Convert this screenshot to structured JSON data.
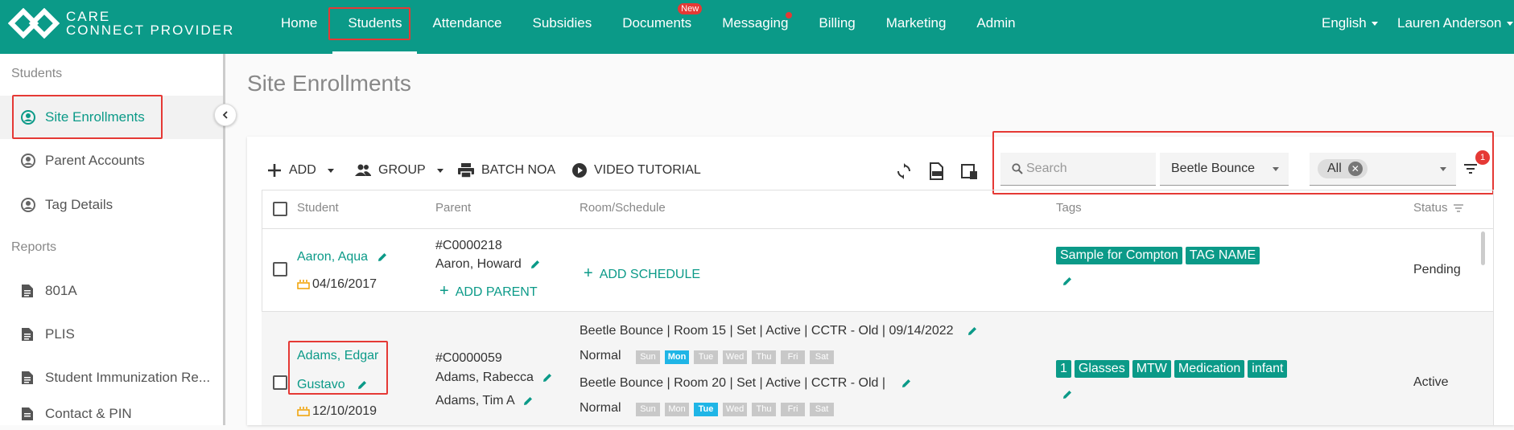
{
  "header": {
    "logo_line1": "CARE",
    "logo_line2": "CONNECT PROVIDER",
    "nav": [
      {
        "label": "Home"
      },
      {
        "label": "Students"
      },
      {
        "label": "Attendance"
      },
      {
        "label": "Subsidies"
      },
      {
        "label": "Documents",
        "badge": "New"
      },
      {
        "label": "Messaging"
      },
      {
        "label": "Billing"
      },
      {
        "label": "Marketing"
      },
      {
        "label": "Admin"
      }
    ],
    "language": "English",
    "user": "Lauren Anderson"
  },
  "sidebar": {
    "section_students": "Students",
    "students_items": [
      {
        "label": "Site Enrollments"
      },
      {
        "label": "Parent Accounts"
      },
      {
        "label": "Tag Details"
      }
    ],
    "section_reports": "Reports",
    "reports_items": [
      {
        "label": "801A"
      },
      {
        "label": "PLIS"
      },
      {
        "label": "Student Immunization Re..."
      },
      {
        "label": "Contact & PIN"
      }
    ]
  },
  "main": {
    "title": "Site Enrollments",
    "toolbar": {
      "add": "ADD",
      "group": "GROUP",
      "batch_noa": "BATCH NOA",
      "video_tutorial": "VIDEO TUTORIAL"
    },
    "filters": {
      "search_placeholder": "Search",
      "site": "Beetle Bounce",
      "status_chip": "All",
      "filter_count": "1"
    },
    "columns": {
      "student": "Student",
      "parent": "Parent",
      "room": "Room/Schedule",
      "tags": "Tags",
      "status": "Status"
    },
    "rows": [
      {
        "student": "Aaron, Aqua",
        "dob": "04/16/2017",
        "parent_id": "#C0000218",
        "parent_name": "Aaron, Howard",
        "add_parent": "ADD PARENT",
        "add_schedule": "ADD SCHEDULE",
        "tags": [
          "Sample for Compton",
          "TAG NAME"
        ],
        "status": "Pending"
      },
      {
        "student_line1": "Adams, Edgar",
        "student_line2": "Gustavo",
        "dob": "12/10/2019",
        "parent_id": "#C0000059",
        "parent_name": "Adams, Rabecca",
        "parent_name2": "Adams, Tim A",
        "schedule1": "Beetle Bounce |  Room 15 |  Set   | Active |  CCTR - Old   | 09/14/2022",
        "schedule1_type": "Normal",
        "schedule2": "Beetle Bounce |  Room 20 |  Set   | Active |  CCTR - Old   |",
        "schedule2_type": "Normal",
        "days": [
          "Sun",
          "Mon",
          "Tue",
          "Wed",
          "Thu",
          "Fri",
          "Sat"
        ],
        "tags": [
          "1",
          "Glasses",
          "MTW",
          "Medication",
          "infant"
        ],
        "status": "Active"
      }
    ]
  },
  "colors": {
    "brand": "#0b9a88",
    "highlight": "#e53935",
    "day_active": "#1fb5e6"
  }
}
